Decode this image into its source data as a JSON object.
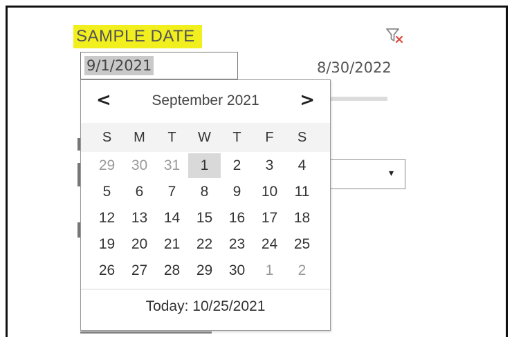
{
  "field": {
    "title": "SAMPLE DATE",
    "start_value": "9/1/2021",
    "end_value": "8/30/2022"
  },
  "icons": {
    "filter": "clear-filter-icon",
    "dropdown_caret": "▾"
  },
  "calendar": {
    "month_label": "September 2021",
    "prev": "<",
    "next": ">",
    "weekdays": [
      "S",
      "M",
      "T",
      "W",
      "T",
      "F",
      "S"
    ],
    "weeks": [
      [
        "29",
        "30",
        "31",
        "1",
        "2",
        "3",
        "4"
      ],
      [
        "5",
        "6",
        "7",
        "8",
        "9",
        "10",
        "11"
      ],
      [
        "12",
        "13",
        "14",
        "15",
        "16",
        "17",
        "18"
      ],
      [
        "19",
        "20",
        "21",
        "22",
        "23",
        "24",
        "25"
      ],
      [
        "26",
        "27",
        "28",
        "29",
        "30",
        "1",
        "2"
      ]
    ],
    "selected_day": "1",
    "today_label": "Today:",
    "today_value": "10/25/2021"
  },
  "colors": {
    "highlight": "#f2ef1e",
    "selected_day_bg": "#d9d9d9",
    "filter_x": "#e0473b"
  }
}
